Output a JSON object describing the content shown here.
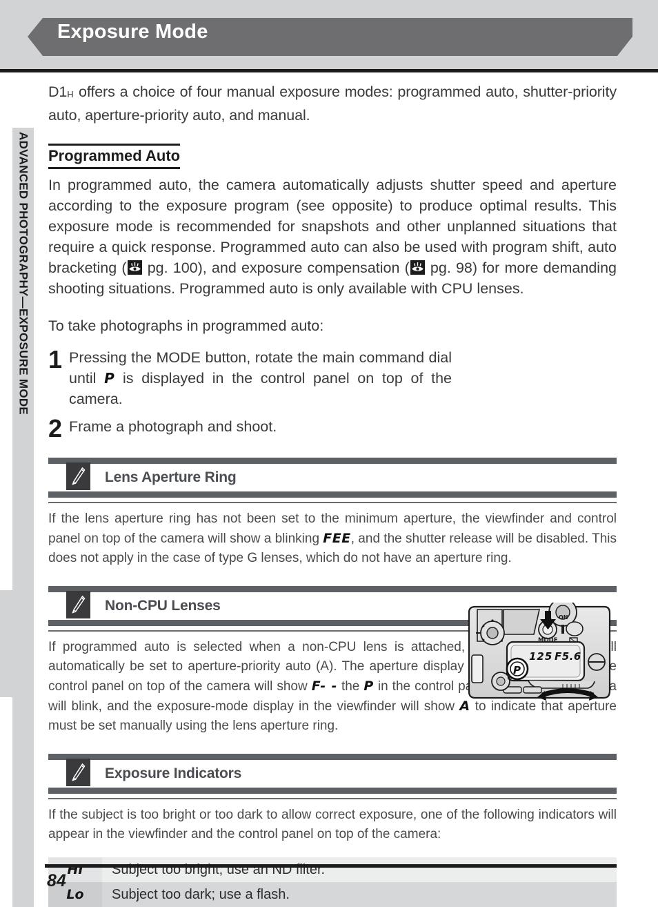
{
  "header": {
    "title": "Exposure Mode",
    "banner_color": "#6e6e70",
    "band_color": "#d2d3d5"
  },
  "sidebar": {
    "label": "ADVANCED PHOTOGRAPHY—EXPOSURE MODE",
    "color": "#d2d3d5"
  },
  "intro": {
    "model": "D1",
    "model_sub": "H",
    "text": " offers a choice of four manual exposure modes: programmed auto, shutter-priority auto, aperture-priority auto, and manual."
  },
  "programmed_auto": {
    "heading": "Programmed Auto",
    "para_1": "In programmed auto, the camera automatically adjusts shutter speed and aperture according to the exposure program (see opposite) to produce optimal results.  This exposure mode is recommended for snapshots and other unplanned situations that require a quick response.  Programmed auto can also be used with program shift, auto bracketing (",
    "ref_1": " pg. 100), and exposure compensation (",
    "ref_2": " pg. 98) for more demanding shooting situations.  Programmed auto is only available with CPU lenses.",
    "lead_in": "To take photographs in programmed auto:",
    "steps": [
      {
        "number": "1",
        "text_before": "Pressing the MODE button, rotate the main command dial until ",
        "symbol": "P",
        "text_after": " is displayed in the control panel on top of the camera."
      },
      {
        "number": "2",
        "text_before": "Frame a photograph and shoot.",
        "symbol": "",
        "text_after": ""
      }
    ]
  },
  "camera_figure": {
    "lcd_shutter_speed": "125",
    "lcd_aperture": "F5.6",
    "mode_button_label": "MODE",
    "mode_indicator": "P",
    "power_label": "ON",
    "icon_names": [
      "camera-top-illustration",
      "mode-button",
      "down-arrow-callout",
      "command-dial-rotation-arrow",
      "control-panel-lcd"
    ]
  },
  "notes": [
    {
      "icon": "pencil-icon",
      "title": "Lens Aperture Ring",
      "body_1": "If the lens aperture ring has not been set to the minimum aperture, the viewfinder and control panel on top of the camera will show a blinking ",
      "symbol_1": "FEE",
      "body_2": ", and the shutter release will be disabled.  This does not apply in the case of type G lenses, which do not have an aperture ring."
    },
    {
      "icon": "pencil-icon",
      "title": "Non-CPU Lenses",
      "body_1": "If programmed auto is selected when a non-CPU lens is attached, the exposure mode will automatically be set to aperture-priority auto (A). The aperture display in the viewfinder and the control panel on top of the camera will show ",
      "symbol_1": "F- -",
      "body_2": " the ",
      "symbol_2": "P",
      "body_3": " in the control panel on top of the camera will blink, and the exposure-mode display in the viewfinder will show ",
      "symbol_3": "A",
      "body_4": " to indicate that aperture must be set manually using the lens aperture ring."
    },
    {
      "icon": "pencil-icon",
      "title": "Exposure Indicators",
      "body_1": "If the subject is too bright or too dark to allow correct exposure, one of the following indicators will appear in the viewfinder and the control panel on top of the camera:"
    }
  ],
  "indicator_table": {
    "rows": [
      {
        "symbol": "HI",
        "description": "Subject too bright; use an ND filter."
      },
      {
        "symbol": "Lo",
        "description": "Subject too dark; use a flash."
      }
    ]
  },
  "footer": {
    "page_number": "84"
  }
}
